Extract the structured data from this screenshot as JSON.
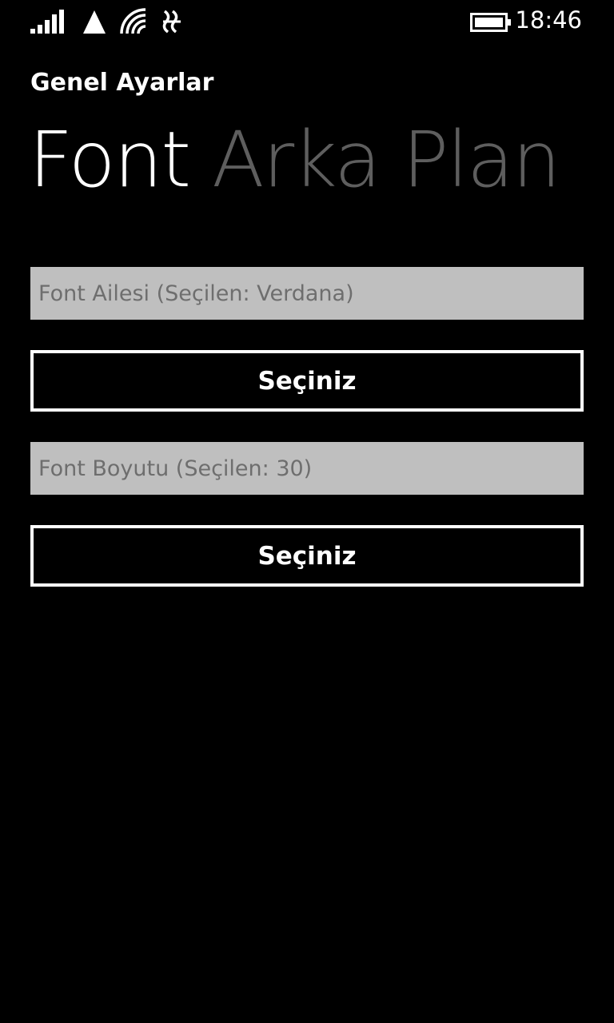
{
  "status_bar": {
    "time": "18:46",
    "icons": [
      "signal-strength-icon",
      "mobile-data-icon",
      "wifi-icon",
      "nfc-icon",
      "battery-icon"
    ]
  },
  "app": {
    "title": "Genel Ayarlar"
  },
  "pivot": {
    "items": [
      {
        "label": "Font",
        "active": true
      },
      {
        "label": "Arka Plan",
        "active": false
      }
    ]
  },
  "font_family": {
    "placeholder": "Font Ailesi (Seçilen: Verdana)",
    "button_label": "Seçiniz"
  },
  "font_size": {
    "placeholder": "Font Boyutu (Seçilen: 30)",
    "button_label": "Seçiniz"
  },
  "colors": {
    "background": "#000000",
    "foreground": "#ffffff",
    "inactive_pivot": "#5e5e5e",
    "field_background": "#bfbfbf",
    "field_text": "#6e6e6e"
  }
}
